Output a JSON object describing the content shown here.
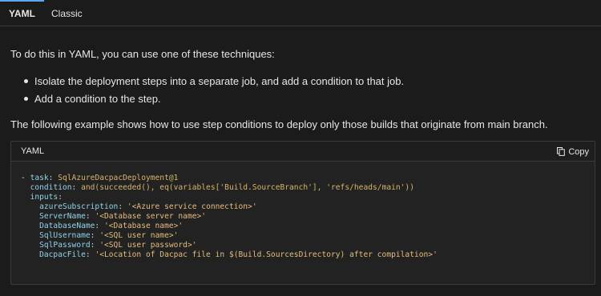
{
  "tabs": [
    {
      "label": "YAML",
      "active": true
    },
    {
      "label": "Classic",
      "active": false
    }
  ],
  "intro": "To do this in YAML, you can use one of these techniques:",
  "bullets": [
    "Isolate the deployment steps into a separate job, and add a condition to that job.",
    "Add a condition to the step."
  ],
  "example_text": "The following example shows how to use step conditions to deploy only those builds that originate from main branch.",
  "code": {
    "language": "YAML",
    "copy_label": "Copy",
    "lines": [
      {
        "dash": "- ",
        "indent": "",
        "key": "task",
        "sep": ": ",
        "value": "SqlAzureDacpacDeployment@1"
      },
      {
        "dash": "",
        "indent": "  ",
        "key": "condition",
        "sep": ": ",
        "value": "and(succeeded(), eq(variables['Build.SourceBranch'], 'refs/heads/main'))"
      },
      {
        "dash": "",
        "indent": "  ",
        "key": "inputs",
        "sep": ":",
        "value": ""
      },
      {
        "dash": "",
        "indent": "    ",
        "key": "azureSubscription",
        "sep": ": ",
        "value": "'<Azure service connection>'"
      },
      {
        "dash": "",
        "indent": "    ",
        "key": "ServerName",
        "sep": ": ",
        "value": "'<Database server name>'"
      },
      {
        "dash": "",
        "indent": "    ",
        "key": "DatabaseName",
        "sep": ": ",
        "value": "'<Database name>'"
      },
      {
        "dash": "",
        "indent": "    ",
        "key": "SqlUsername",
        "sep": ": ",
        "value": "'<SQL user name>'"
      },
      {
        "dash": "",
        "indent": "    ",
        "key": "SqlPassword",
        "sep": ": ",
        "value": "'<SQL user password>'"
      },
      {
        "dash": "",
        "indent": "    ",
        "key": "DacpacFile",
        "sep": ": ",
        "value": "'<Location of Dacpac file in $(Build.SourcesDirectory) after compilation>'"
      }
    ]
  },
  "colors": {
    "background": "#1b1b1b",
    "accent": "#5ea7f0",
    "code_key": "#8fd3ea",
    "code_string": "#e5bd7b"
  },
  "icons": {
    "copy": "copy-icon"
  }
}
